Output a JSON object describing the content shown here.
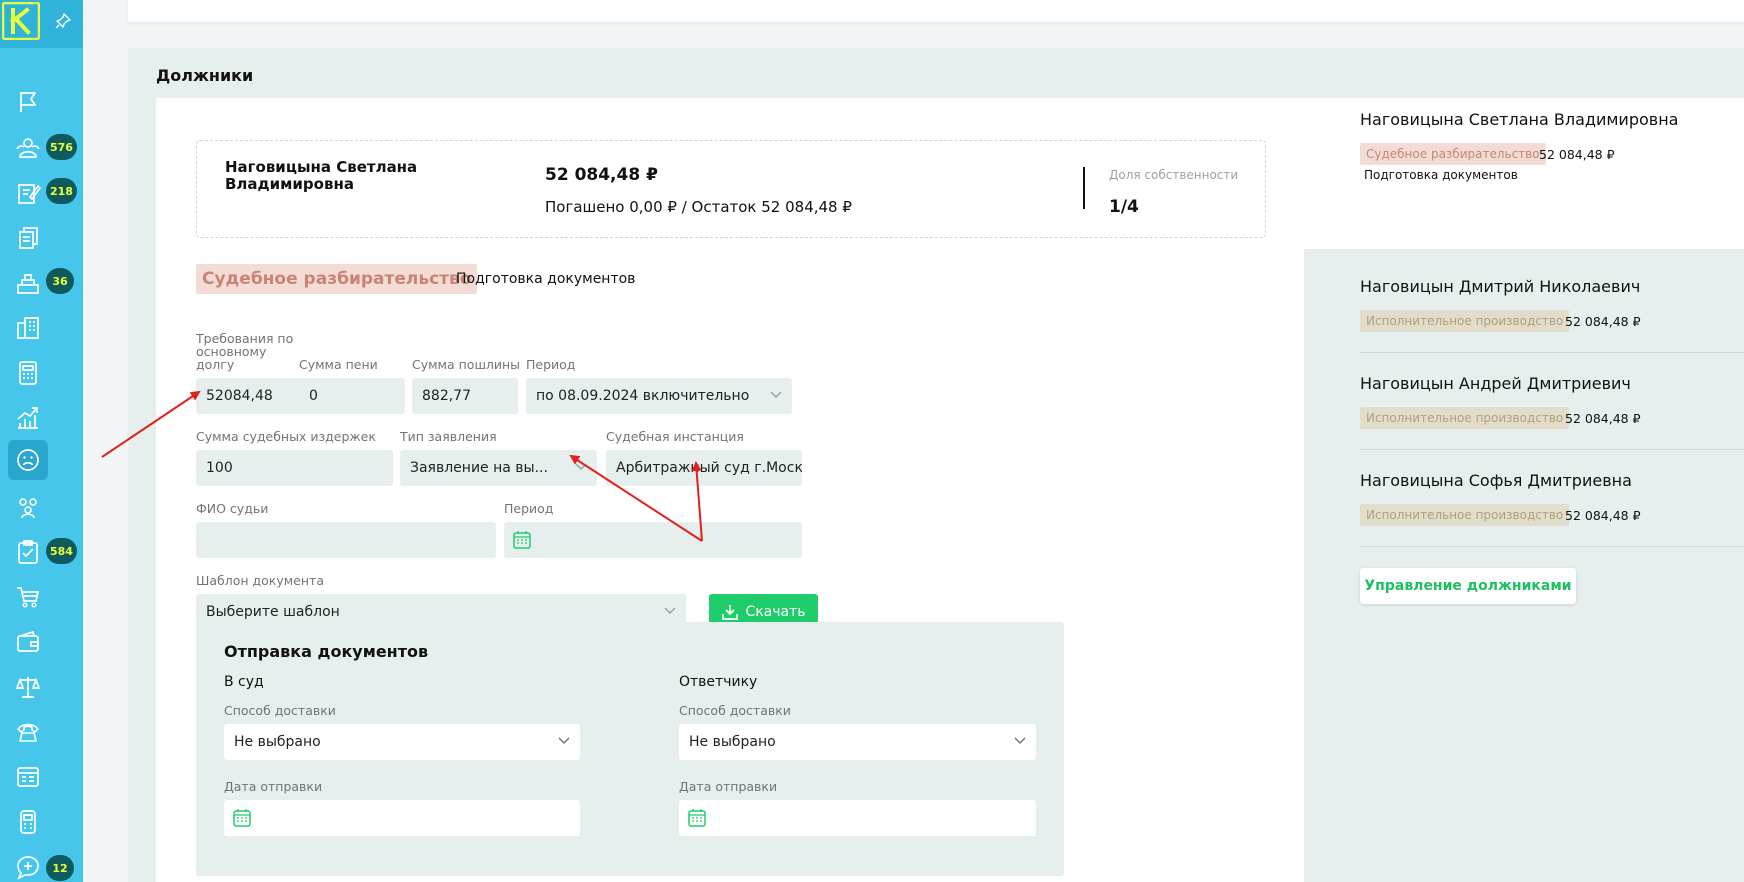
{
  "sidebar": {
    "items": [
      {
        "icon": "flag-icon",
        "badge": ""
      },
      {
        "icon": "users-group-icon",
        "badge": "576"
      },
      {
        "icon": "edit-document-icon",
        "badge": "218"
      },
      {
        "icon": "documents-icon",
        "badge": ""
      },
      {
        "icon": "inbox-tray-icon",
        "badge": "36"
      },
      {
        "icon": "building-icon",
        "badge": ""
      },
      {
        "icon": "calculator-icon",
        "badge": ""
      },
      {
        "icon": "chart-growth-icon",
        "badge": ""
      },
      {
        "icon": "sad-face-icon",
        "badge": "",
        "active": true
      },
      {
        "icon": "team-icon",
        "badge": ""
      },
      {
        "icon": "checklist-icon",
        "badge": "584"
      },
      {
        "icon": "cart-icon",
        "badge": ""
      },
      {
        "icon": "wallet-icon",
        "badge": ""
      },
      {
        "icon": "scales-icon",
        "badge": ""
      },
      {
        "icon": "phone-icon",
        "badge": ""
      },
      {
        "icon": "calendar-board-icon",
        "badge": ""
      },
      {
        "icon": "device-icon",
        "badge": ""
      },
      {
        "icon": "chat-add-icon",
        "badge": "12"
      }
    ],
    "logo_letter": "K"
  },
  "section": {
    "title": "Должники"
  },
  "summary": {
    "name": "Наговицына Светлана Владимировна",
    "amount": "52 084,48 ₽",
    "paid": "Погашено 0,00 ₽ / Остаток 52 084,48 ₽",
    "share_label": "Доля собственности",
    "share_value": "1/4"
  },
  "stage": {
    "tag": "Судебное разбирательство",
    "sub": "Подготовка документов"
  },
  "form": {
    "main_debt_label": "Требования по основному долгу",
    "main_debt_value": "52084,48",
    "penalty_label": "Сумма пени",
    "penalty_value": "0",
    "fee_label": "Сумма пошлины",
    "fee_value": "882,77",
    "period_label": "Период",
    "period_value": "по 08.09.2024 включительно",
    "costs_label": "Сумма судебных издержек",
    "costs_value": "100",
    "claim_type_label": "Тип заявления",
    "claim_type_value": "Заявление на вы...",
    "court_label": "Судебная инстанция",
    "court_value": "Арбитражный суд г.Моск",
    "judge_label": "ФИО судьи",
    "judge_value": "",
    "period2_label": "Период",
    "template_label": "Шаблон документа",
    "template_value": "Выберите шаблон",
    "download_label": "Скачать"
  },
  "sending": {
    "title": "Отправка документов",
    "court": {
      "title": "В суд",
      "delivery_label": "Способ доставки",
      "delivery_value": "Не выбрано",
      "date_label": "Дата отправки"
    },
    "defendant": {
      "title": "Ответчику",
      "delivery_label": "Способ доставки",
      "delivery_value": "Не выбрано",
      "date_label": "Дата отправки"
    }
  },
  "debtors": [
    {
      "name": "Наговицына Светлана Владимировна",
      "tag": "Судебное разбирательство",
      "tag_kind": "court",
      "sum": "52 084,48 ₽",
      "sub": "Подготовка документов"
    },
    {
      "name": "Наговицын Дмитрий Николаевич",
      "tag": "Исполнительное производство",
      "tag_kind": "exec",
      "sum": "52 084,48 ₽"
    },
    {
      "name": "Наговицын Андрей Дмитриевич",
      "tag": "Исполнительное производство",
      "tag_kind": "exec",
      "sum": "52 084,48 ₽"
    },
    {
      "name": "Наговицына Софья Дмитриевна",
      "tag": "Исполнительное производство",
      "tag_kind": "exec",
      "sum": "52 084,48 ₽"
    }
  ],
  "manage_button": "Управление должниками",
  "colors": {
    "sidebar": "#46c6ea",
    "accent_green": "#1fce6b",
    "court_tag_bg": "#f4dcd6",
    "exec_tag_bg": "#e2dccb",
    "annotation_red": "#e0211d"
  }
}
